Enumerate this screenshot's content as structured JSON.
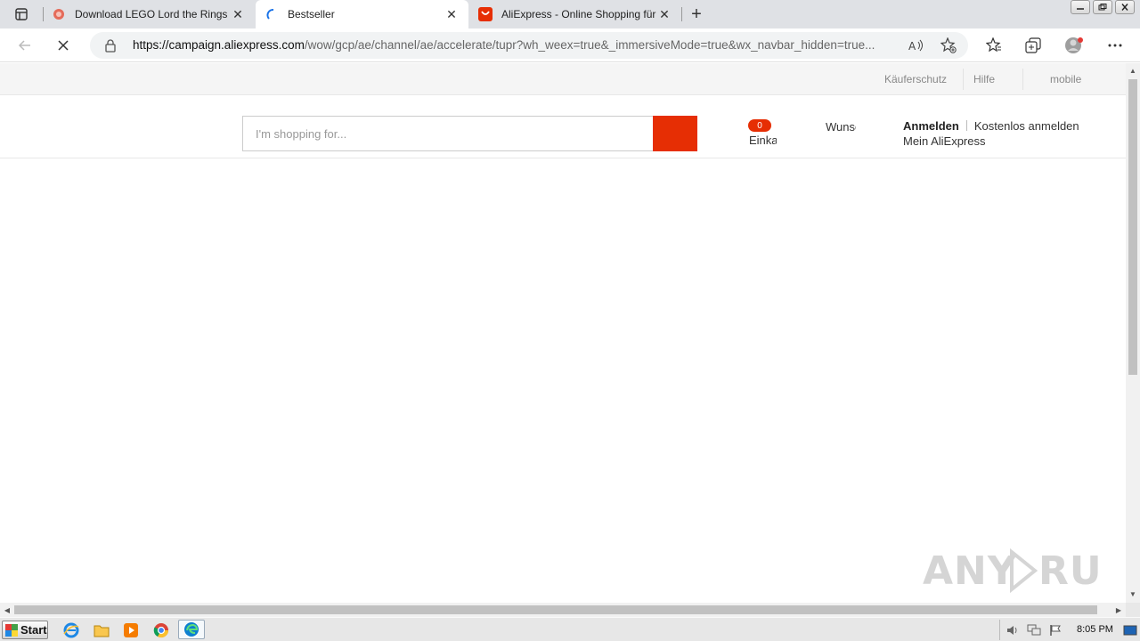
{
  "browser": {
    "tabs": [
      {
        "title": "Download LEGO Lord the Rings r",
        "favicon": "lego-red-icon",
        "active": false
      },
      {
        "title": "Bestseller",
        "favicon": "loading-icon",
        "active": true
      },
      {
        "title": "AliExpress - Online Shopping für",
        "favicon": "aliexpress-icon",
        "active": false
      }
    ],
    "close_glyph": "✕",
    "new_tab_glyph": "+",
    "url_host": "https://campaign.aliexpress.com",
    "url_path": "/wow/gcp/ae/channel/ae/accelerate/tupr?wh_weex=true&_immersiveMode=true&wx_navbar_hidden=true...",
    "accent": "#e62e04"
  },
  "site": {
    "top_links": [
      "Käuferschutz",
      "Hilfe",
      "mobile"
    ],
    "search_placeholder": "I'm shopping for...",
    "cart_count": "0",
    "cart_label": "Einkaufswagen",
    "wish_label": "Wunschliste",
    "signin": "Anmelden",
    "join": "Kostenlos anmelden",
    "my_account": "Mein AliExpress"
  },
  "watermark": "ANY RUN",
  "taskbar": {
    "start_label": "Start",
    "clock": "8:05 PM"
  }
}
